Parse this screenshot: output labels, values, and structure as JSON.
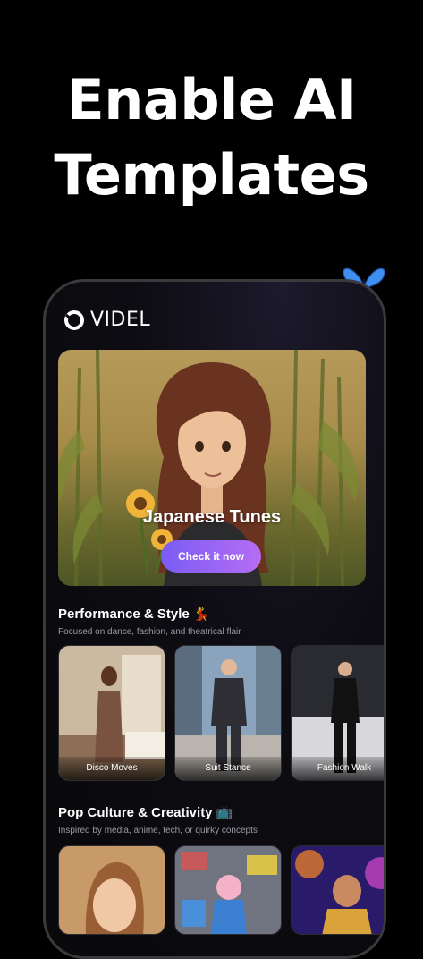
{
  "headline": {
    "line1": "Enable AI",
    "line2": "Templates"
  },
  "app": {
    "logo_text": "VIDEL"
  },
  "hero": {
    "title": "Japanese Tunes",
    "button": "Check it now"
  },
  "sections": [
    {
      "title": "Performance & Style 💃",
      "subtitle": "Focused on dance, fashion, and theatrical flair",
      "cards": [
        {
          "label": "Disco Moves"
        },
        {
          "label": "Suit Stance"
        },
        {
          "label": "Fashion Walk"
        }
      ]
    },
    {
      "title": "Pop Culture & Creativity 📺",
      "subtitle": "Inspired by media, anime, tech, or quirky concepts"
    }
  ],
  "colors": {
    "accent_start": "#7a5cf5",
    "accent_end": "#b56df3",
    "background": "#000000"
  },
  "icons": {
    "logo": "videl-logo-icon",
    "decoration": "butterfly-icon"
  }
}
